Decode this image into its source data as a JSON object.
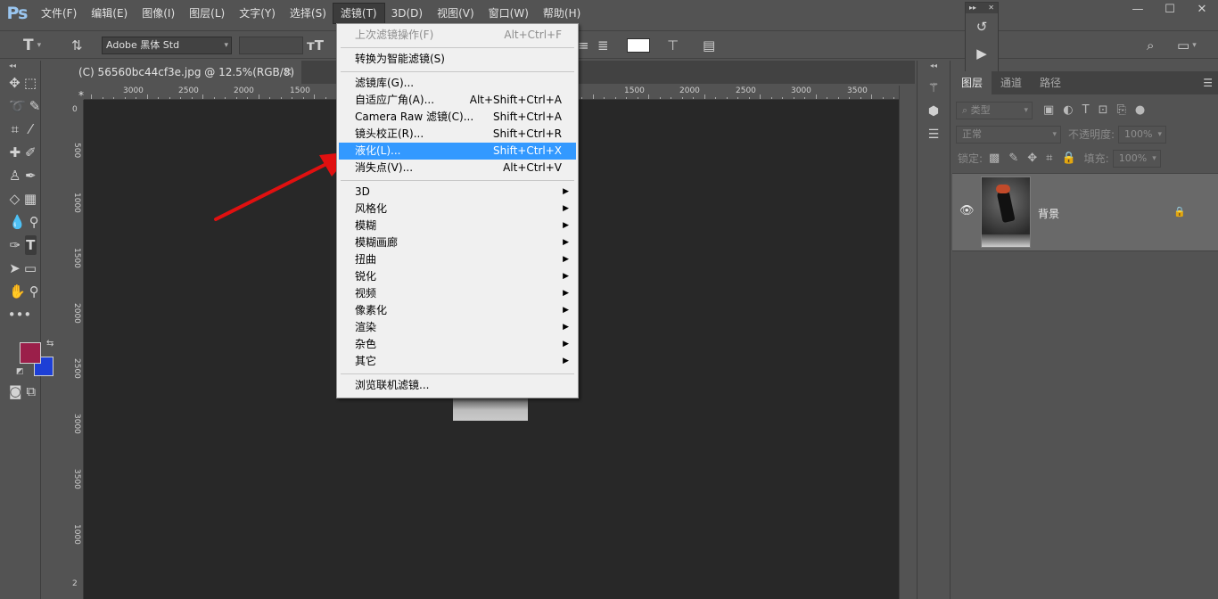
{
  "app": {
    "logo": "Ps",
    "menu": [
      "文件(F)",
      "编辑(E)",
      "图像(I)",
      "图层(L)",
      "文字(Y)",
      "选择(S)",
      "滤镜(T)",
      "3D(D)",
      "视图(V)",
      "窗口(W)",
      "帮助(H)"
    ],
    "active_menu_index": 6,
    "window_controls": [
      "—",
      "☐",
      "✕"
    ]
  },
  "options": {
    "tool_glyph": "T",
    "font_family": "Adobe 黑体 Std"
  },
  "document": {
    "tab_title": "(C) 56560bc44cf3e.jpg @ 12.5%(RGB/8) *",
    "close": "✕"
  },
  "rulers": {
    "top_labels": [
      "3000",
      "2500",
      "2000",
      "1500",
      "1000",
      "1500",
      "2000",
      "2500",
      "3000",
      "3500"
    ],
    "left_labels": [
      "0",
      "500",
      "1000",
      "1500",
      "2000",
      "2500",
      "3000",
      "3500",
      "1000",
      "1500",
      "2"
    ]
  },
  "filter_menu": {
    "items": [
      {
        "label": "上次滤镜操作(F)",
        "shortcut": "Alt+Ctrl+F",
        "disabled": true
      },
      {
        "sep": true
      },
      {
        "label": "转换为智能滤镜(S)"
      },
      {
        "sep": true
      },
      {
        "label": "滤镜库(G)..."
      },
      {
        "label": "自适应广角(A)...",
        "shortcut": "Alt+Shift+Ctrl+A"
      },
      {
        "label": "Camera Raw 滤镜(C)...",
        "shortcut": "Shift+Ctrl+A"
      },
      {
        "label": "镜头校正(R)...",
        "shortcut": "Shift+Ctrl+R"
      },
      {
        "label": "液化(L)...",
        "shortcut": "Shift+Ctrl+X",
        "highlighted": true
      },
      {
        "label": "消失点(V)...",
        "shortcut": "Alt+Ctrl+V"
      },
      {
        "sep": true
      },
      {
        "label": "3D",
        "submenu": true
      },
      {
        "label": "风格化",
        "submenu": true
      },
      {
        "label": "模糊",
        "submenu": true
      },
      {
        "label": "模糊画廊",
        "submenu": true
      },
      {
        "label": "扭曲",
        "submenu": true
      },
      {
        "label": "锐化",
        "submenu": true
      },
      {
        "label": "视频",
        "submenu": true
      },
      {
        "label": "像素化",
        "submenu": true
      },
      {
        "label": "渲染",
        "submenu": true
      },
      {
        "label": "杂色",
        "submenu": true
      },
      {
        "label": "其它",
        "submenu": true
      },
      {
        "sep": true
      },
      {
        "label": "浏览联机滤镜..."
      }
    ]
  },
  "layers_panel": {
    "tabs": [
      "图层",
      "通道",
      "路径"
    ],
    "filter_kind": "类型",
    "blend_mode": "正常",
    "opacity_label": "不透明度:",
    "opacity_value": "100%",
    "lock_label": "锁定:",
    "fill_label": "填充:",
    "fill_value": "100%",
    "layers": [
      {
        "name": "背景",
        "locked": true,
        "visible": true
      }
    ]
  },
  "colors": {
    "foreground": "#9b1f4a",
    "background": "#1d3fd6",
    "menu_highlight": "#3399ff",
    "annotation_arrow": "#e01010"
  }
}
